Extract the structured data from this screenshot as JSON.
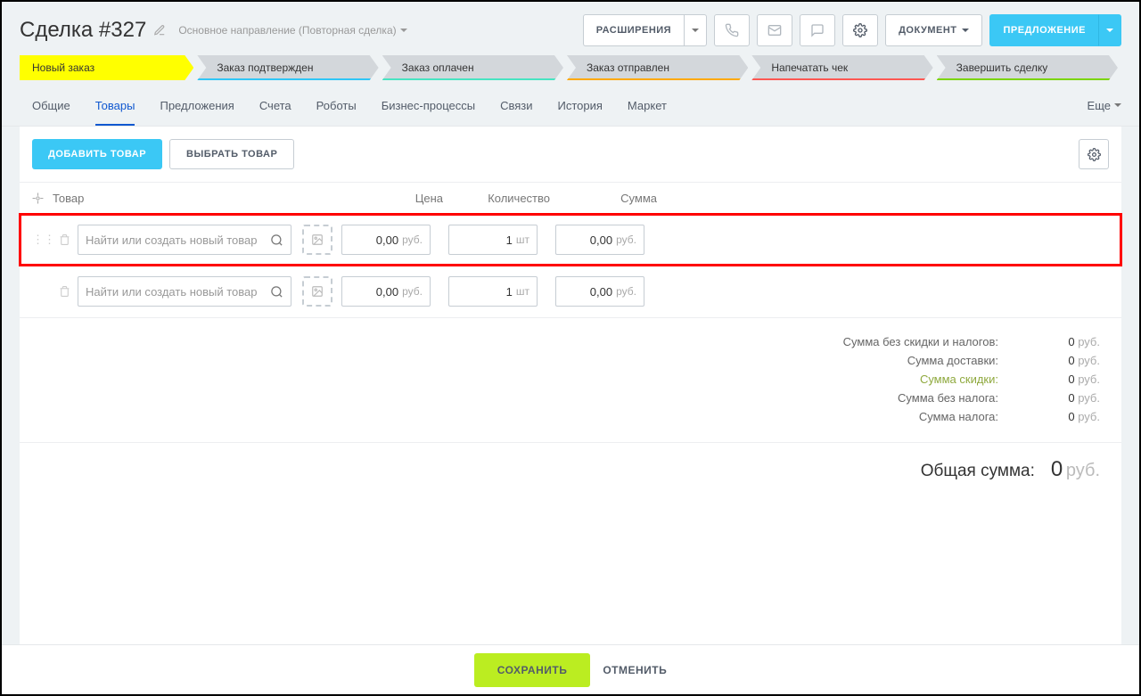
{
  "header": {
    "title": "Сделка #327",
    "subtitle": "Основное направление (Повторная сделка)",
    "buttons": {
      "extensions": "РАСШИРЕНИЯ",
      "document": "ДОКУМЕНТ",
      "proposal": "ПРЕДЛОЖЕНИЕ"
    }
  },
  "stages": [
    "Новый заказ",
    "Заказ подтвержден",
    "Заказ оплачен",
    "Заказ отправлен",
    "Напечатать чек",
    "Завершить сделку"
  ],
  "tabs": [
    "Общие",
    "Товары",
    "Предложения",
    "Счета",
    "Роботы",
    "Бизнес-процессы",
    "Связи",
    "История",
    "Маркет"
  ],
  "tabs_more": "Еще",
  "toolbar": {
    "add": "ДОБАВИТЬ ТОВАР",
    "select": "ВЫБРАТЬ ТОВАР"
  },
  "columns": {
    "product": "Товар",
    "price": "Цена",
    "qty": "Количество",
    "sum": "Сумма"
  },
  "currency": "руб.",
  "unit": "шт",
  "rows": [
    {
      "placeholder": "Найти или создать новый товар",
      "price": "0,00",
      "qty": "1",
      "sum": "0,00"
    },
    {
      "placeholder": "Найти или создать новый товар",
      "price": "0,00",
      "qty": "1",
      "sum": "0,00"
    }
  ],
  "totals": {
    "subtotal": {
      "label": "Сумма без скидки и налогов:",
      "value": "0"
    },
    "shipping": {
      "label": "Сумма доставки:",
      "value": "0"
    },
    "discount": {
      "label": "Сумма скидки:",
      "value": "0"
    },
    "pretax": {
      "label": "Сумма без налога:",
      "value": "0"
    },
    "tax": {
      "label": "Сумма налога:",
      "value": "0"
    },
    "grand": {
      "label": "Общая сумма:",
      "value": "0"
    }
  },
  "footer": {
    "save": "СОХРАНИТЬ",
    "cancel": "ОТМЕНИТЬ"
  }
}
